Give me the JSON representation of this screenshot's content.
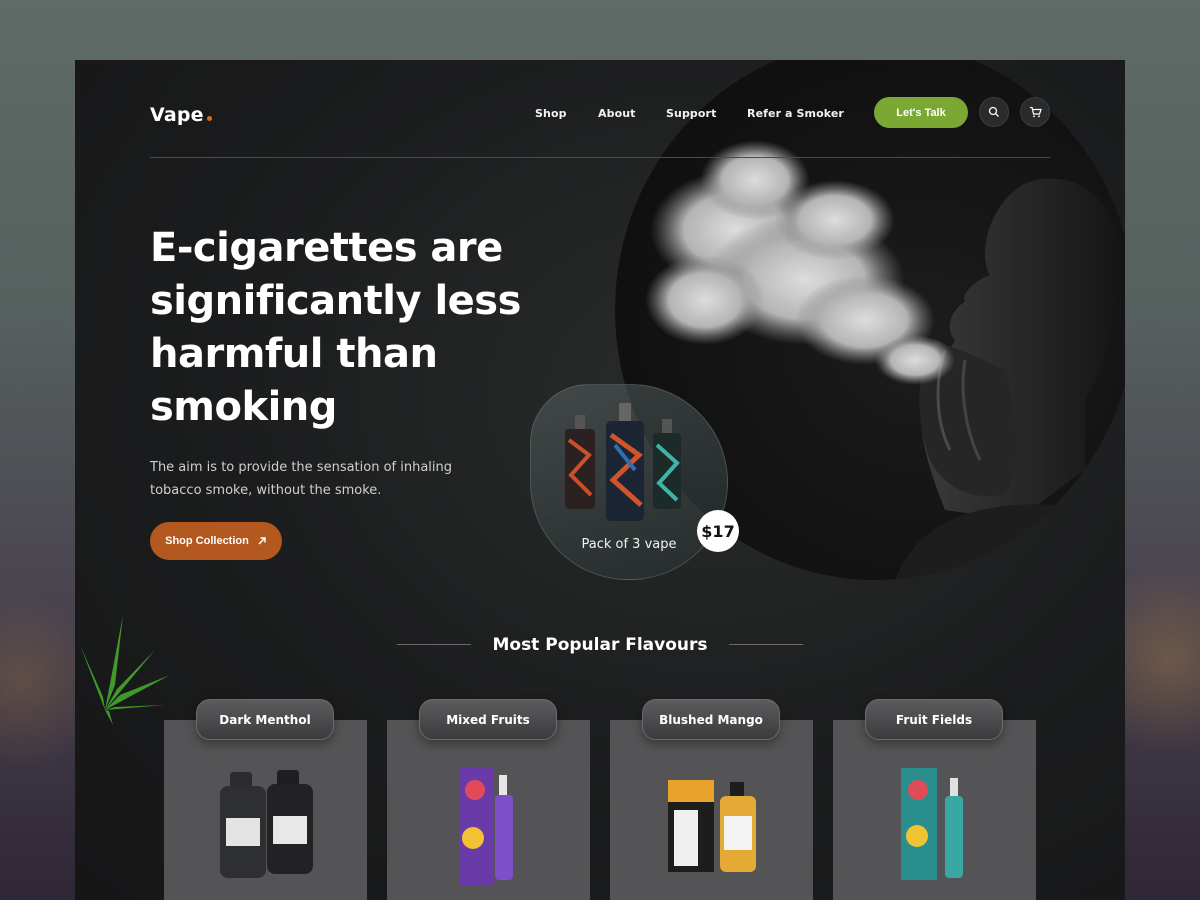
{
  "brand": {
    "name": "Vape"
  },
  "nav": {
    "items": [
      "Shop",
      "About",
      "Support",
      "Refer a Smoker"
    ],
    "cta_label": "Let's Talk"
  },
  "icons": {
    "search": "search-icon",
    "cart": "cart-icon",
    "arrow": "arrow-up-right-icon",
    "leaf": "cannabis-leaf-icon"
  },
  "hero": {
    "title_lines": [
      "E-cigarettes are",
      "significantly less",
      "harmful than",
      "smoking"
    ],
    "subtitle_lines": [
      "The aim is to provide the sensation of inhaling",
      "tobacco smoke, without the smoke."
    ],
    "button_label": "Shop Collection"
  },
  "featured_product": {
    "label": "Pack of 3 vape",
    "price": "$17"
  },
  "section": {
    "title": "Most Popular Flavours"
  },
  "flavours": [
    {
      "name": "Dark Menthol"
    },
    {
      "name": "Mixed Fruits"
    },
    {
      "name": "Blushed Mango"
    },
    {
      "name": "Fruit Fields"
    }
  ],
  "colors": {
    "accent_green": "#7aa833",
    "accent_orange": "#b3591f",
    "logo_dot": "#d0702c",
    "background": "#1b1c1d"
  }
}
